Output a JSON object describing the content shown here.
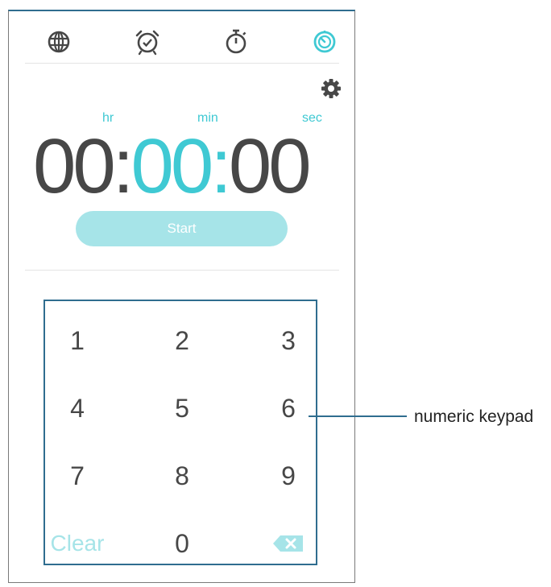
{
  "tabs": [
    {
      "name": "world-clock",
      "icon": "globe-icon",
      "active": false
    },
    {
      "name": "alarm",
      "icon": "alarm-clock-icon",
      "active": false
    },
    {
      "name": "stopwatch",
      "icon": "stopwatch-icon",
      "active": false
    },
    {
      "name": "timer",
      "icon": "timer-icon",
      "active": true
    }
  ],
  "settings_icon": "gear-icon",
  "timer": {
    "units": {
      "hr": "hr",
      "min": "min",
      "sec": "sec"
    },
    "hours": "00",
    "minutes": "00",
    "seconds": "00",
    "separator": ":"
  },
  "start_label": "Start",
  "keypad": {
    "keys": [
      "1",
      "2",
      "3",
      "4",
      "5",
      "6",
      "7",
      "8",
      "9",
      "Clear",
      "0"
    ],
    "backspace_icon": "backspace-icon"
  },
  "annotation": {
    "label": "numeric keypad"
  },
  "colors": {
    "accent": "#3fc9d3",
    "accent_light": "#a6e4e8",
    "digit": "#474747",
    "callout": "#2f6d8f"
  }
}
